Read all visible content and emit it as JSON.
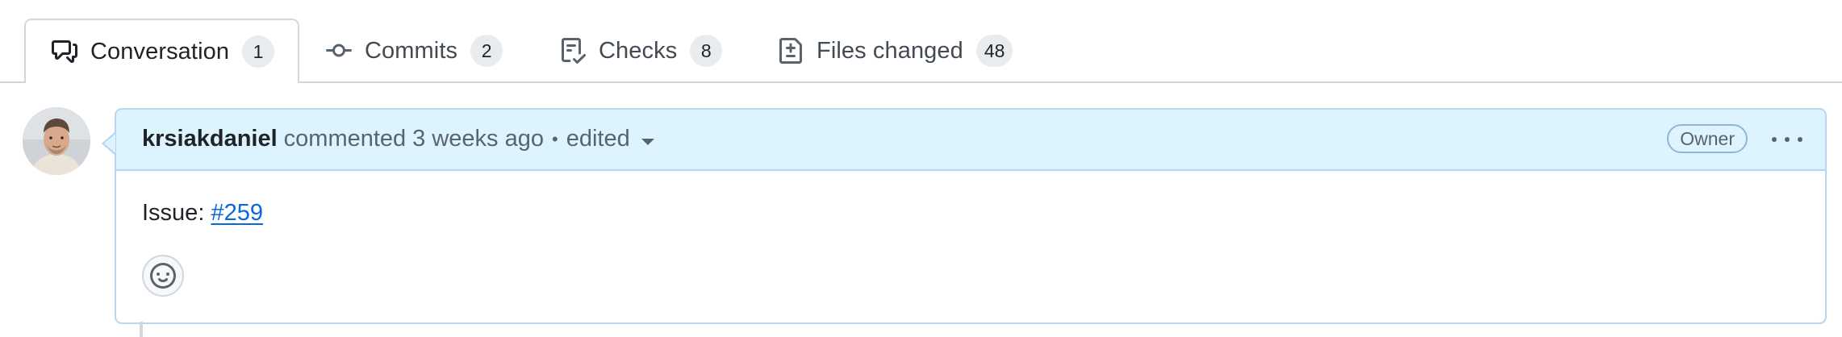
{
  "tabs": [
    {
      "label": "Conversation",
      "count": "1",
      "icon": "comment-discussion-icon",
      "active": true
    },
    {
      "label": "Commits",
      "count": "2",
      "icon": "git-commit-icon",
      "active": false
    },
    {
      "label": "Checks",
      "count": "8",
      "icon": "checklist-icon",
      "active": false
    },
    {
      "label": "Files changed",
      "count": "48",
      "icon": "file-diff-icon",
      "active": false
    }
  ],
  "comment": {
    "author": "krsiakdaniel",
    "action": "commented",
    "time": "3 weeks ago",
    "separator": "•",
    "edited": "edited",
    "role_badge": "Owner",
    "body_prefix": "Issue:",
    "body_link": "#259"
  },
  "colors": {
    "header_bg": "#ddf4ff",
    "header_border": "#b6d5f2",
    "link": "#0969da",
    "counter_bg": "#e9ecef"
  }
}
